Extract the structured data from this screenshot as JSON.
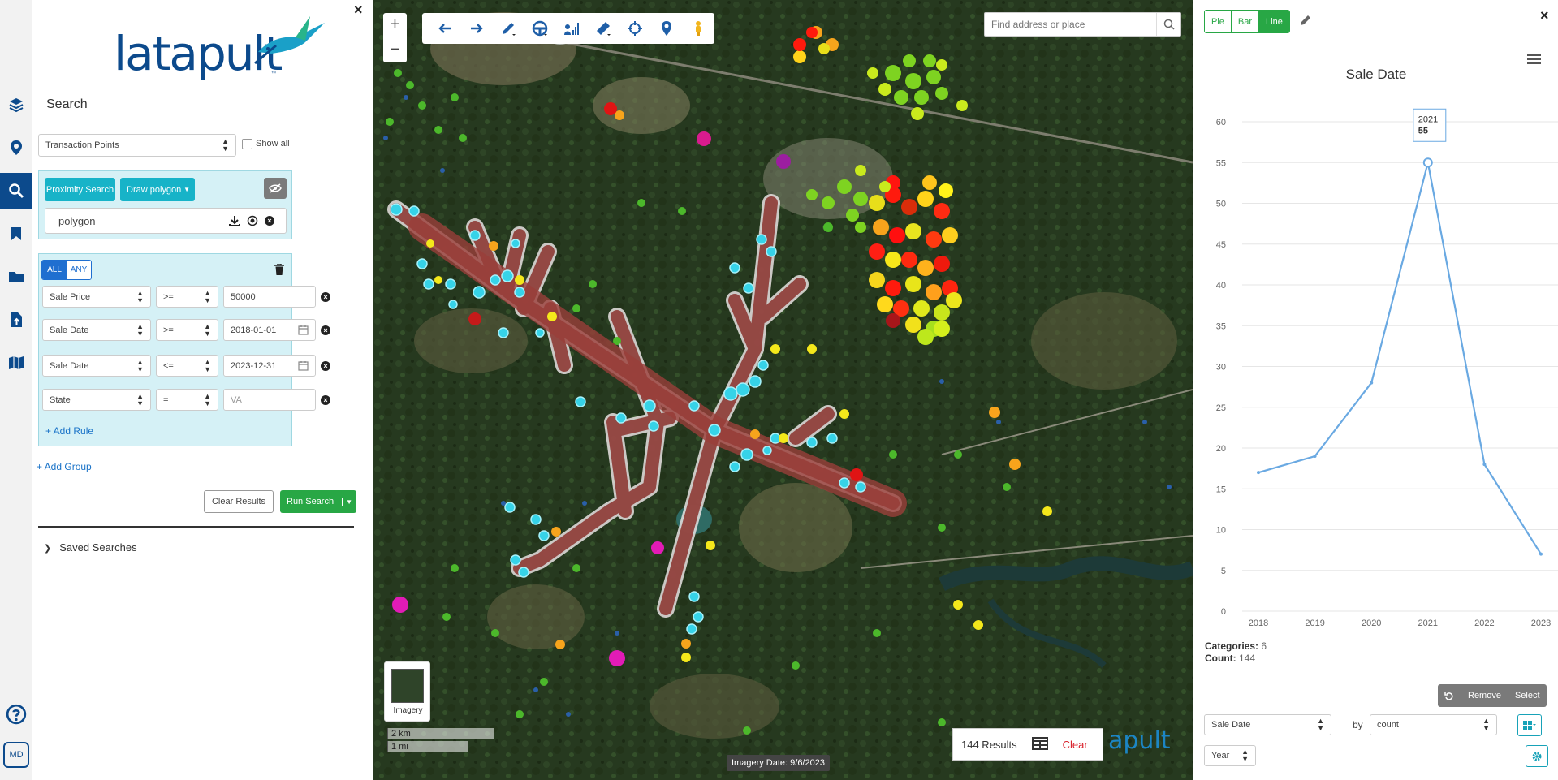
{
  "sidebar_rail": {
    "items": [
      {
        "icon": "layers-icon"
      },
      {
        "icon": "location-pin-icon"
      },
      {
        "icon": "search-icon",
        "active": true
      },
      {
        "icon": "bookmark-icon"
      },
      {
        "icon": "folder-icon"
      },
      {
        "icon": "file-upload-icon"
      },
      {
        "icon": "map-icon"
      }
    ],
    "help_icon": "help-icon",
    "user_initials": "MD"
  },
  "search_panel": {
    "logo_text": "latapult",
    "logo_tm": "™",
    "title": "Search",
    "close": "×",
    "layer_select": "Transaction Points",
    "show_all_label": "Show all",
    "proximity_button": "Proximity Search",
    "draw_polygon_button": "Draw polygon",
    "polygon_name": "polygon",
    "logic": {
      "all": "ALL",
      "any": "ANY",
      "selected": "ALL"
    },
    "rules": [
      {
        "field": "Sale Price",
        "operator": ">=",
        "value": "50000",
        "placeholder": false
      },
      {
        "field": "Sale Date",
        "operator": ">=",
        "value": "2018-01-01",
        "placeholder": false
      },
      {
        "field": "Sale Date",
        "operator": "<=",
        "value": "2023-12-31",
        "placeholder": false
      },
      {
        "field": "State",
        "operator": "=",
        "value": "VA",
        "placeholder": true
      }
    ],
    "add_rule": "+ Add Rule",
    "add_group": "+ Add Group",
    "clear_results": "Clear Results",
    "run_search": "Run Search",
    "saved_searches": "Saved Searches"
  },
  "map": {
    "zoom_in": "+",
    "zoom_out": "−",
    "tools": [
      "arrow-left-icon",
      "arrow-right-icon",
      "pencil-icon",
      "steering-wheel-icon",
      "signal-bars-icon",
      "ruler-icon",
      "crosshair-icon",
      "map-marker-icon",
      "pegman-icon"
    ],
    "search_placeholder": "Find address or place",
    "basemap_label": "Imagery",
    "scale_km": "2 km",
    "scale_mi": "1 mi",
    "imagery_date": "Imagery Date: 9/6/2023",
    "results_count": "144 Results",
    "clear": "Clear",
    "watermark": "apult"
  },
  "chart_panel": {
    "tabs": [
      "Pie",
      "Bar",
      "Line"
    ],
    "active_tab": "Line",
    "close": "×",
    "categories_label": "Categories:",
    "categories_value": "6",
    "count_label": "Count:",
    "count_value": "144",
    "actions": {
      "remove": "Remove",
      "select": "Select"
    },
    "group_field": "Sale Date",
    "by_label": "by",
    "metric": "count",
    "interval": "Year",
    "accent": "#6aa9e2"
  },
  "chart_data": {
    "type": "line",
    "title": "Sale Date",
    "categories": [
      "2018",
      "2019",
      "2020",
      "2021",
      "2022",
      "2023"
    ],
    "values": [
      17,
      19,
      28,
      55,
      18,
      7
    ],
    "ylim": [
      0,
      60
    ],
    "yticks": [
      "0",
      "5",
      "10",
      "15",
      "20",
      "25",
      "30",
      "35",
      "40",
      "45",
      "50",
      "55",
      "60"
    ],
    "tooltip": {
      "category": "2021",
      "value": "55"
    },
    "grid": true,
    "xlabel": "",
    "ylabel": ""
  }
}
